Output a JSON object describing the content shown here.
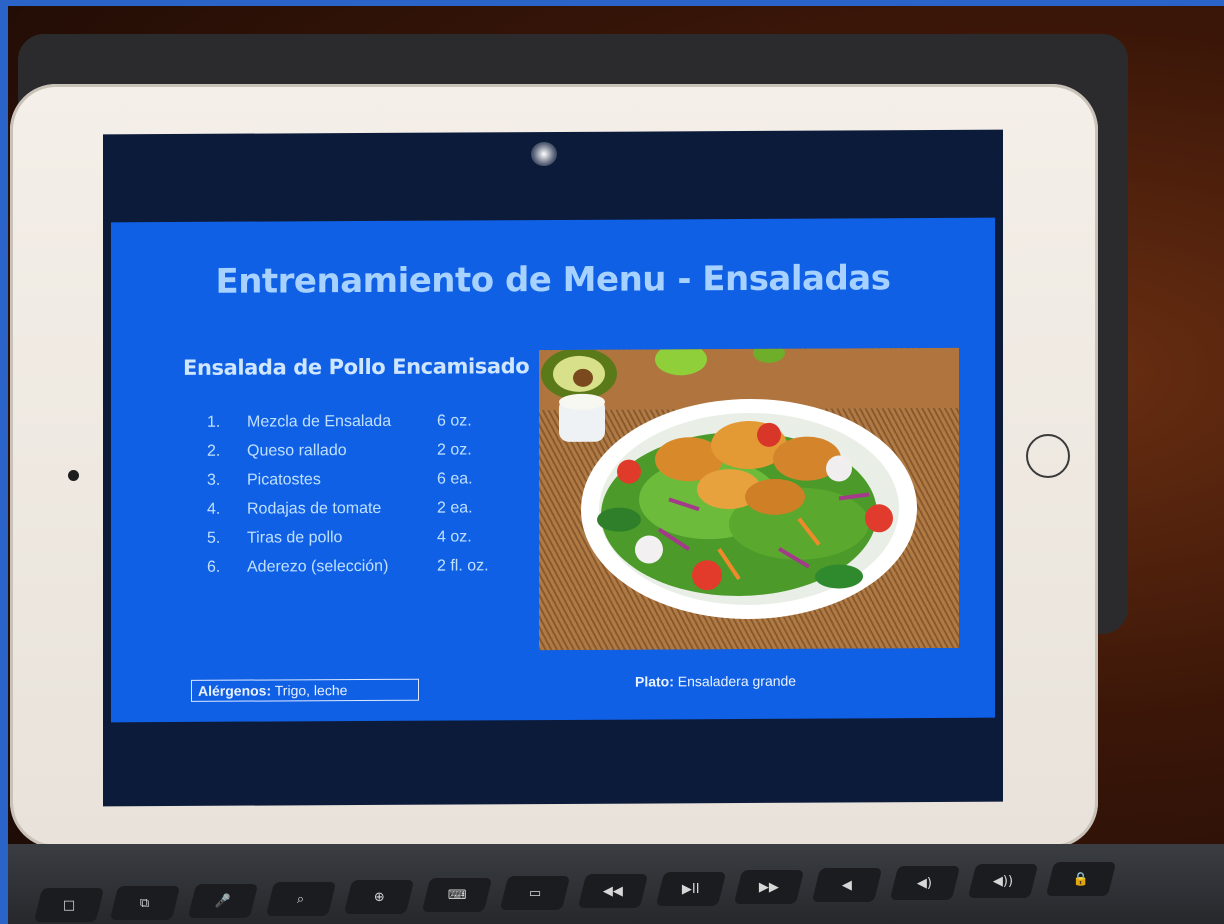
{
  "slide": {
    "title": "Entrenamiento de Menu - Ensaladas",
    "dish_name": "Ensalada de Pollo Encamisado",
    "ingredients": [
      {
        "num": "1.",
        "name": "Mezcla de Ensalada",
        "qty": "6 oz."
      },
      {
        "num": "2.",
        "name": "Queso rallado",
        "qty": "2 oz."
      },
      {
        "num": "3.",
        "name": "Picatostes",
        "qty": "6 ea."
      },
      {
        "num": "4.",
        "name": "Rodajas de tomate",
        "qty": "2 ea."
      },
      {
        "num": "5.",
        "name": "Tiras de pollo",
        "qty": "4 oz."
      },
      {
        "num": "6.",
        "name": "Aderezo (selección)",
        "qty": "2 fl. oz."
      }
    ],
    "allergens_label": "Alérgenos:",
    "allergens_value": "Trigo, leche",
    "plate_label": "Plato:",
    "plate_value": "Ensaladera grande"
  },
  "keyboard": {
    "keys": [
      "□",
      "⧉",
      "🎤",
      "⌕",
      "⊕",
      "⌨",
      "▭",
      "◀◀",
      "▶II",
      "▶▶",
      "◀",
      "◀)",
      "◀))",
      "🔒"
    ]
  },
  "colors": {
    "slide_background": "#1060e6",
    "title_color": "#a7d2ff",
    "text_color": "#bfe0ff"
  }
}
